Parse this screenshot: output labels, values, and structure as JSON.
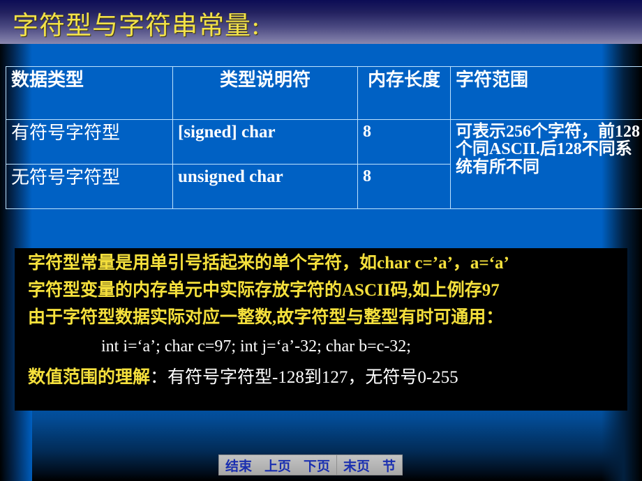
{
  "slide": {
    "title": "字符型与字符串常量:",
    "title_color": "#f2e24a",
    "background_color": "#005fc0",
    "header_gradient_top": "#0c0c55",
    "header_gradient_bottom": "#8b88ae"
  },
  "table": {
    "border_color": "#bfe4ff",
    "text_color": "#ffffff",
    "headers": {
      "data_type": "数据类型",
      "type_specifier": "类型说明符",
      "memory_length": "内存长度",
      "char_range": "字符范围"
    },
    "rows": [
      {
        "data_type": "有符号字符型",
        "type_specifier": "[signed] char",
        "memory_length": "8"
      },
      {
        "data_type": "无符号字符型",
        "type_specifier": "unsigned char",
        "memory_length": "8"
      }
    ],
    "char_range_merged": "可表示256个字符，前128个同ASCII.后128不同系统有所不同"
  },
  "note": {
    "background_color": "#000000",
    "highlight_color": "#f5e03c",
    "plain_color": "#ffffff",
    "line1": "字符型常量是用单引号括起来的单个字符，如char c=’a’，a=‘a’",
    "line2": "字符型变量的内存单元中实际存放字符的ASCII码,如上例存97",
    "line3": "由于字符型数据实际对应一整数,故字符型与整型有时可通用：",
    "line4": "int i=‘a’;      char c=97;    int j=‘a’-32;  char b=c-32;",
    "line5_label": "数值范围的理解",
    "line5_rest": "：有符号字符型-128到127，无符号0-255"
  },
  "nav": {
    "text_color": "#1a2fb0",
    "buttons": [
      {
        "label": "结束"
      },
      {
        "label": "上页"
      },
      {
        "label": "下页"
      },
      {
        "label": "末页"
      },
      {
        "label": "节"
      }
    ]
  }
}
